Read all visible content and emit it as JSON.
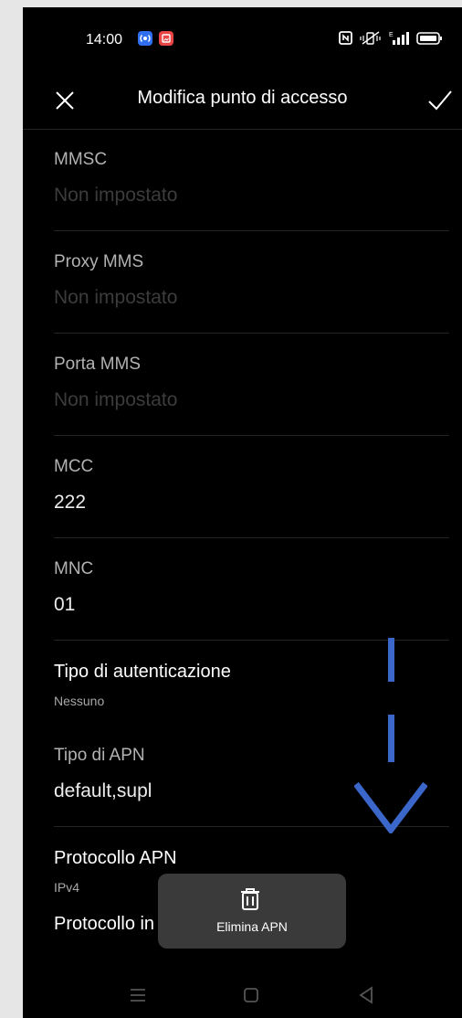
{
  "status_bar": {
    "time": "14:00",
    "notification_icons": [
      "hotspot-icon",
      "screenshot-icon"
    ],
    "system_icons": [
      "nfc-icon",
      "vibrate-icon",
      "signal-icon",
      "battery-icon"
    ]
  },
  "app_bar": {
    "title": "Modifica punto di accesso",
    "close_icon": "close-icon",
    "confirm_icon": "check-icon"
  },
  "fields": [
    {
      "label": "MMSC",
      "value": "Non impostato",
      "empty": true
    },
    {
      "label": "Proxy MMS",
      "value": "Non impostato",
      "empty": true
    },
    {
      "label": "Porta MMS",
      "value": "Non impostato",
      "empty": true
    },
    {
      "label": "MCC",
      "value": "222",
      "empty": false
    },
    {
      "label": "MNC",
      "value": "01",
      "empty": false
    }
  ],
  "selects": {
    "auth_type": {
      "label": "Tipo di autenticazione",
      "value": "Nessuno"
    },
    "apn_type": {
      "label": "Tipo di APN",
      "value": "default,supl"
    },
    "apn_protocol": {
      "label": "Protocollo APN",
      "value": "IPv4"
    },
    "roaming_protocol": {
      "label": "Protocollo in roaming"
    }
  },
  "toast": {
    "label": "Elimina APN",
    "icon": "trash-icon"
  },
  "nav_bar": {
    "icons": [
      "menu-icon",
      "home-icon",
      "back-icon"
    ]
  },
  "colors": {
    "background": "#000000",
    "scroll_hint": "#3a67c9",
    "toast": "#3a3a3a"
  }
}
